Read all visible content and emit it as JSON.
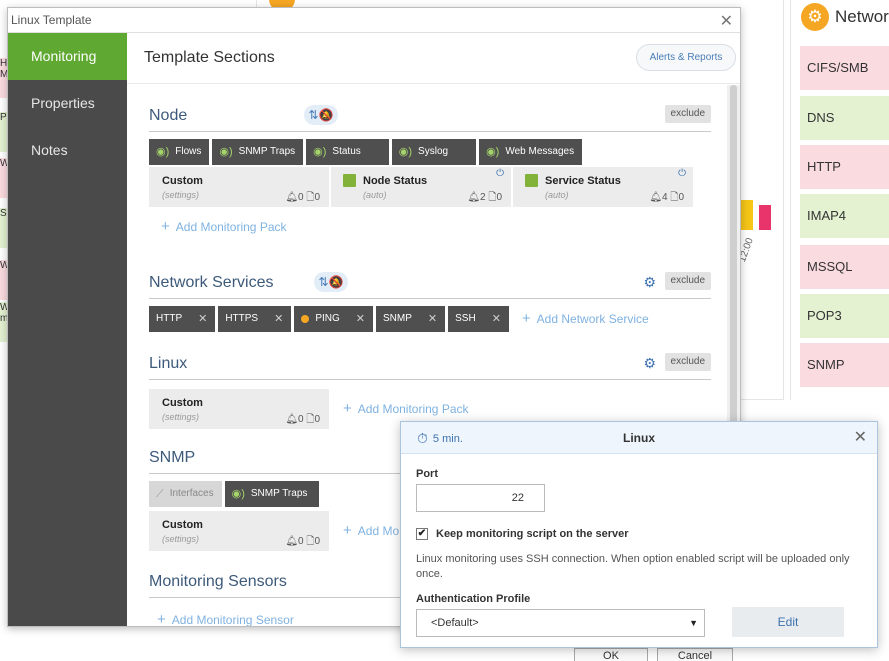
{
  "background": {
    "left_stubs": [
      "H\nM",
      "P",
      "W",
      "S",
      "W",
      "W\nm"
    ],
    "chart_tick": "12:00",
    "network_panel": {
      "title": "Networ",
      "services": [
        {
          "name": "CIFS/SMB",
          "color": "#fadbe0"
        },
        {
          "name": "DNS",
          "color": "#e4f2d2"
        },
        {
          "name": "HTTP",
          "color": "#fadbe0"
        },
        {
          "name": "IMAP4",
          "color": "#e4f2d2"
        },
        {
          "name": "MSSQL",
          "color": "#fadbe0"
        },
        {
          "name": "POP3",
          "color": "#e4f2d2"
        },
        {
          "name": "SNMP",
          "color": "#fadbe0"
        }
      ]
    },
    "ok_label": "OK",
    "cancel_label": "Cancel"
  },
  "dialog": {
    "title": "Linux Template",
    "sidebar": [
      {
        "label": "Monitoring",
        "active": true
      },
      {
        "label": "Properties",
        "active": false
      },
      {
        "label": "Notes",
        "active": false
      }
    ],
    "header": "Template Sections",
    "alerts_button": "Alerts & Reports",
    "exclude_label": "exclude",
    "sections": {
      "node": {
        "title": "Node",
        "chips": [
          "Flows",
          "SNMP Traps",
          "Status",
          "Syslog",
          "Web Messages"
        ],
        "packs": [
          {
            "name": "Custom",
            "sub": "(settings)",
            "alerts": "0",
            "docs": "0"
          },
          {
            "name": "Node Status",
            "sub": "(auto)",
            "alerts": "2",
            "docs": "0"
          },
          {
            "name": "Service Status",
            "sub": "(auto)",
            "alerts": "4",
            "docs": "0"
          }
        ],
        "add_label": "Add Monitoring Pack"
      },
      "network_services": {
        "title": "Network Services",
        "chips": [
          "HTTP",
          "HTTPS",
          "PING",
          "SNMP",
          "SSH"
        ],
        "add_label": "Add Network Service"
      },
      "linux": {
        "title": "Linux",
        "packs": [
          {
            "name": "Custom",
            "sub": "(settings)",
            "alerts": "0",
            "docs": "0"
          }
        ],
        "add_label": "Add Monitoring Pack"
      },
      "snmp": {
        "title": "SNMP",
        "chips": [
          "Interfaces",
          "SNMP Traps"
        ],
        "packs": [
          {
            "name": "Custom",
            "sub": "(settings)",
            "alerts": "0",
            "docs": "0"
          }
        ],
        "add_label": "Add Mo"
      },
      "sensors": {
        "title": "Monitoring Sensors",
        "add_label": "Add Monitoring Sensor"
      }
    }
  },
  "popup": {
    "interval": "5 min.",
    "title": "Linux",
    "port_label": "Port",
    "port_value": "22",
    "keep_script_label": "Keep monitoring script on the server",
    "keep_script_checked": true,
    "info_text": "Linux monitoring uses SSH connection. When option enabled script will be uploaded only once.",
    "auth_label": "Authentication Profile",
    "auth_value": "<Default>",
    "edit_label": "Edit"
  },
  "colors": {
    "accent_green": "#5fa832",
    "sidebar_bg": "#4a4a4a",
    "chip_bg": "#4f4f4f",
    "link_blue": "#7fb2e0",
    "brand_orange": "#f5a623"
  }
}
